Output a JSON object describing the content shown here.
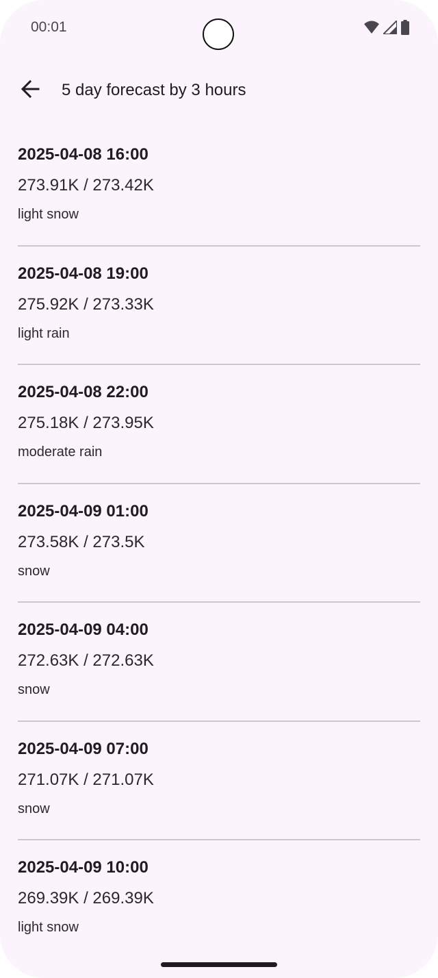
{
  "status_bar": {
    "time": "00:01",
    "icons": [
      "wifi-icon",
      "signal-icon",
      "battery-icon"
    ]
  },
  "app_bar": {
    "back_icon": "arrow-back-icon",
    "title": "5 day forecast by 3 hours"
  },
  "forecast": [
    {
      "datetime": "2025-04-08 16:00",
      "temps": "273.91K / 273.42K",
      "description": "light snow"
    },
    {
      "datetime": "2025-04-08 19:00",
      "temps": "275.92K / 273.33K",
      "description": "light rain"
    },
    {
      "datetime": "2025-04-08 22:00",
      "temps": "275.18K / 273.95K",
      "description": "moderate rain"
    },
    {
      "datetime": "2025-04-09 01:00",
      "temps": "273.58K / 273.5K",
      "description": "snow"
    },
    {
      "datetime": "2025-04-09 04:00",
      "temps": "272.63K / 272.63K",
      "description": "snow"
    },
    {
      "datetime": "2025-04-09 07:00",
      "temps": "271.07K / 271.07K",
      "description": "snow"
    },
    {
      "datetime": "2025-04-09 10:00",
      "temps": "269.39K / 269.39K",
      "description": "light snow"
    }
  ],
  "colors": {
    "background": "#fcf4fc",
    "text": "#1f1b21",
    "divider": "#cdc6cf"
  }
}
